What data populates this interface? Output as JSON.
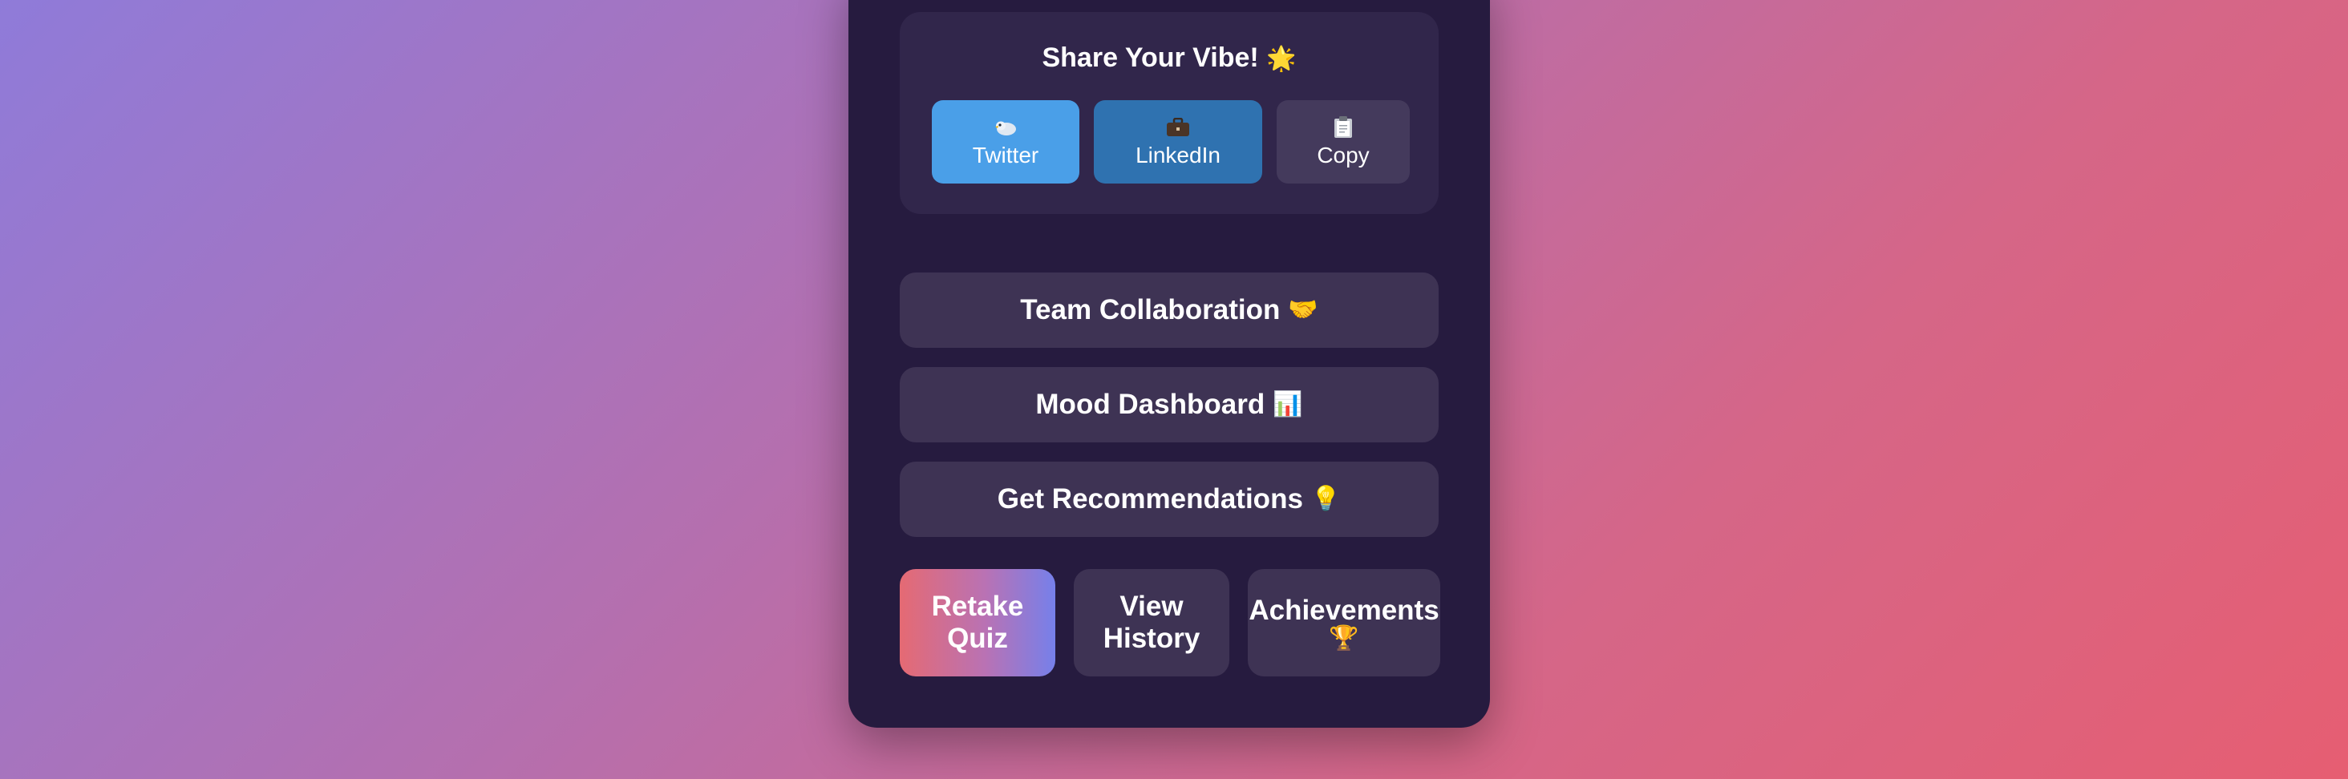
{
  "share": {
    "title": "Share Your Vibe!",
    "title_icon": "star-icon",
    "buttons": [
      {
        "label": "Twitter",
        "icon": "bird-icon",
        "color": "#4a9fe8"
      },
      {
        "label": "LinkedIn",
        "icon": "briefcase-icon",
        "color": "#2f72b0"
      },
      {
        "label": "Copy",
        "icon": "clipboard-icon",
        "color": "#443a5c"
      }
    ]
  },
  "actions": [
    {
      "label": "Team Collaboration",
      "icon": "handshake-icon"
    },
    {
      "label": "Mood Dashboard",
      "icon": "bar-chart-icon"
    },
    {
      "label": "Get Recommendations",
      "icon": "lightbulb-icon"
    }
  ],
  "bottom": {
    "retake": {
      "line1": "Retake",
      "line2": "Quiz"
    },
    "history": {
      "line1": "View",
      "line2": "History"
    },
    "achievements": {
      "label": "Achievements",
      "icon": "trophy-icon"
    }
  },
  "colors": {
    "card_bg": "#261b3f",
    "panel_bg": "#31264b",
    "button_bg": "#3e3354",
    "accent_gradient": [
      "#e56a73",
      "#7680ea"
    ]
  }
}
